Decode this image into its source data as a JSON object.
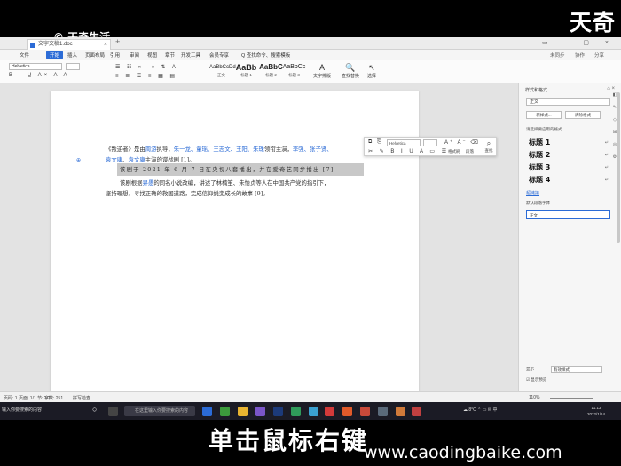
{
  "overlay": {
    "brand": "天奇",
    "brand_left": "© 天奇生活",
    "subtitle": "单击鼠标右键",
    "watermark": "www.caodingbaike.com"
  },
  "app": {
    "tab_title": "文字文稿1.doc",
    "tab_close": "×",
    "tab_add": "+",
    "window_buttons": "▭ – ▢ ×",
    "menu": [
      "文件",
      "开始",
      "插入",
      "页面布局",
      "引用",
      "审阅",
      "视图",
      "章节",
      "开发工具",
      "会员专享"
    ],
    "menu_search": "Q 查找命令、搜索模板",
    "menu_right": [
      "未同步",
      "协作",
      "分享"
    ]
  },
  "ribbon": {
    "font_name": "Helvetica",
    "font_size": "",
    "styles": [
      {
        "sample": "AaBbCcDd",
        "name": "正文"
      },
      {
        "sample": "AaBb",
        "name": "标题 1"
      },
      {
        "sample": "AaBbC",
        "name": "标题 2"
      },
      {
        "sample": "AaBbCc",
        "name": "标题 3"
      }
    ],
    "right_tools": [
      {
        "glyph": "A",
        "label": "文字排版"
      },
      {
        "glyph": "🔍",
        "label": "查找替换"
      },
      {
        "glyph": "↖",
        "label": "选择"
      }
    ]
  },
  "document": {
    "line1_a": "《叛逆者》是由",
    "line1_b": "周游",
    "line1_c": "执导，",
    "line1_d": "朱一龙、童瑶、王志文、",
    "line1_e": "王阳、朱珠",
    "line1_f": "领衔主演，",
    "line1_g": "李强、张子贤、",
    "line2_a": "袁文康",
    "line2_b": "、",
    "line2_c": "袁文康",
    "line2_d": "主演的谍战剧 [1]。",
    "selected_line": "该剧于 2021 年 6 月 7 日在央视八套播出，并在爱奇艺同步播出 [7]",
    "para2_line1_a": "该剧根据",
    "para2_line1_b": "畀愚",
    "para2_line1_c": "的同名小说改编，讲述了林楠笙、朱怡贞等人在中国共产党的指引下，",
    "para2_line2": "坚持理想，寻找正确的救国道路，完成信仰蜕变成长的故事 [9]。"
  },
  "mini_toolbar": {
    "font_name": "Helvetica",
    "format_label": "格式刷",
    "paragraph_label": "段落",
    "side_label": "查找"
  },
  "styles_panel": {
    "title": "样式和格式",
    "current_style": "正文",
    "new_style_button": "新样式...",
    "clear_format_button": "清除格式",
    "pick_label": "请选择要应用的格式",
    "headings": [
      "标题 1",
      "标题 2",
      "标题 3",
      "标题 4"
    ],
    "link_style": "超链接",
    "default_font": "默认段落字体",
    "body_style": "正文",
    "show_label": "显示",
    "show_value": "有效样式",
    "preview_label": "显示预览"
  },
  "status": {
    "left": "页码: 1  页面: 1/1  节: 1/1",
    "word_count": "字数: 251",
    "spellcheck": "拼写检查",
    "zoom": "110%"
  },
  "taskbar": {
    "left_text": "输入你要搜索的内容",
    "search_placeholder": "在这里输入你要搜索的内容",
    "weather": "8°C",
    "time": "11:13",
    "date": "2022/1/14"
  },
  "colors": {
    "accent": "#2b6bd6",
    "selection": "#c8c8c8",
    "taskbar": "#1b1b25"
  }
}
